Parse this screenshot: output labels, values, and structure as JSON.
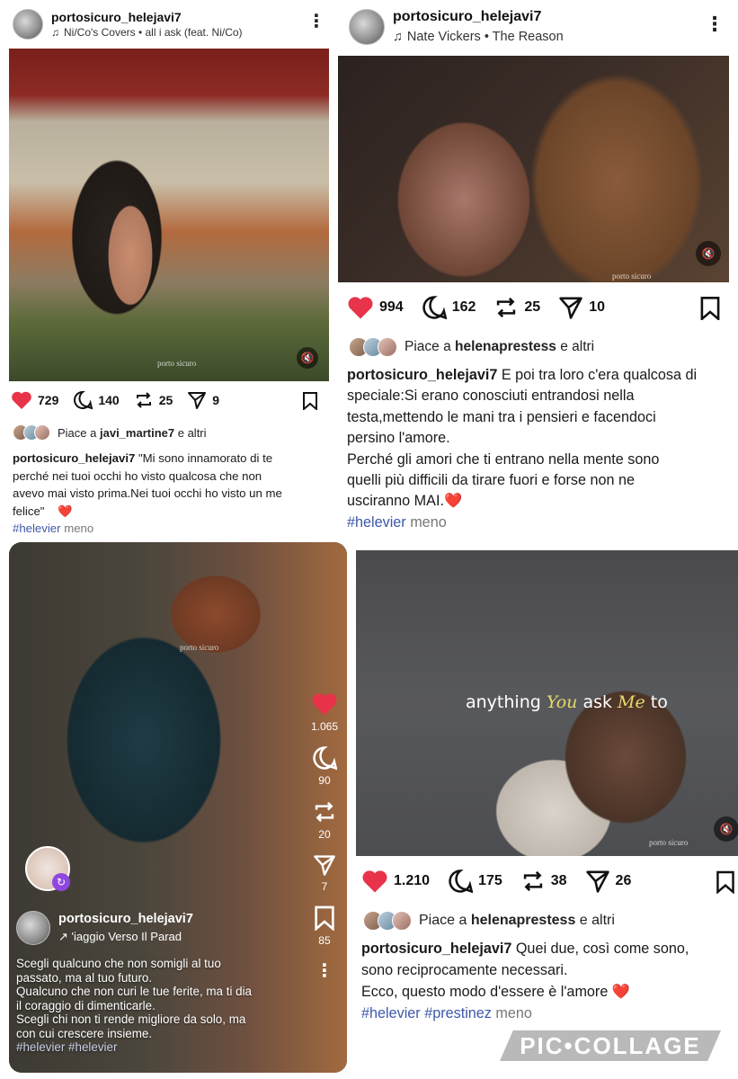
{
  "post1": {
    "username": "portosicuro_helejavi7",
    "track": "Ni/Co's Covers • all i ask (feat. Ni/Co)",
    "watermark": "porto sicuro",
    "likes": "729",
    "comments": "140",
    "reposts": "25",
    "shares": "9",
    "liked_by_prefix": "Piace a",
    "liked_by_user": "javi_martine7",
    "liked_by_suffix": "e altri",
    "caption_user": "portosicuro_helejavi7",
    "caption_l1": "\"Mi sono innamorato di te",
    "caption_l2": "perché nei tuoi occhi ho visto qualcosa che non",
    "caption_l3": "avevo mai visto prima.Nei tuoi occhi ho visto un me",
    "caption_l4": "felice\"",
    "caption_emoji": "❤️",
    "hashtag": "#helevier",
    "more": "meno"
  },
  "post2": {
    "username": "portosicuro_helejavi7",
    "track": "Nate Vickers • The Reason",
    "watermark": "porto sicuro",
    "likes": "994",
    "comments": "162",
    "reposts": "25",
    "shares": "10",
    "liked_by_prefix": "Piace a",
    "liked_by_user": "helenaprestess",
    "liked_by_suffix": "e altri",
    "caption_user": "portosicuro_helejavi7",
    "caption_l1": "E poi tra loro c'era qualcosa di",
    "caption_l2": "speciale:Si erano conosciuti entrandosi nella",
    "caption_l3": "testa,mettendo le mani tra i pensieri e facendoci",
    "caption_l4": "persino l'amore.",
    "caption_l5": "Perché gli amori che ti entrano nella mente sono",
    "caption_l6": "quelli più difficili da tirare fuori e forse non ne",
    "caption_l7": "usciranno MAI.",
    "caption_emoji": "❤️",
    "hashtag": "#helevier",
    "more": "meno"
  },
  "post3": {
    "watermark": "porto sicuro",
    "likes": "1.065",
    "comments": "90",
    "reposts": "20",
    "shares": "7",
    "saves": "85",
    "username": "portosicuro_helejavi7",
    "track": "'iaggio Verso Il Parad",
    "text_l1": "Scegli qualcuno che non somigli al tuo",
    "text_l2": "passato, ma al tuo futuro.",
    "text_l3": "Qualcuno che non curi le tue ferite, ma ti dia",
    "text_l4": "il coraggio di dimenticarle.",
    "text_l5": "Scegli chi non ti rende migliore da solo, ma",
    "text_l6": "con cui crescere insieme.",
    "hashtags": "#helevier #helevier"
  },
  "post4": {
    "overlay_a": "anything ",
    "overlay_b": "You",
    "overlay_c": " ask ",
    "overlay_d": "Me",
    "overlay_e": " to",
    "watermark": "porto sicuro",
    "likes": "1.210",
    "comments": "175",
    "reposts": "38",
    "shares": "26",
    "liked_by_prefix": "Piace a",
    "liked_by_user": "helenaprestess",
    "liked_by_suffix": "e altri",
    "caption_user": "portosicuro_helejavi7",
    "caption_l1": "Quei due, così come sono,",
    "caption_l2": "sono reciprocamente necessari.",
    "caption_l3": "Ecco, questo modo d'essere è l'amore",
    "caption_emoji": "❤️",
    "hashtag1": "#helevier",
    "hashtag2": "#prestinez",
    "more": "meno"
  },
  "collage_logo": "PIC•COLLAGE",
  "colors": {
    "heart": "#e8334a",
    "hashtag": "#3d58a8"
  },
  "icons": [
    "heart-icon",
    "comment-icon",
    "repost-icon",
    "share-icon",
    "bookmark-icon",
    "music-note-icon",
    "kebab-menu-icon",
    "mute-icon"
  ]
}
